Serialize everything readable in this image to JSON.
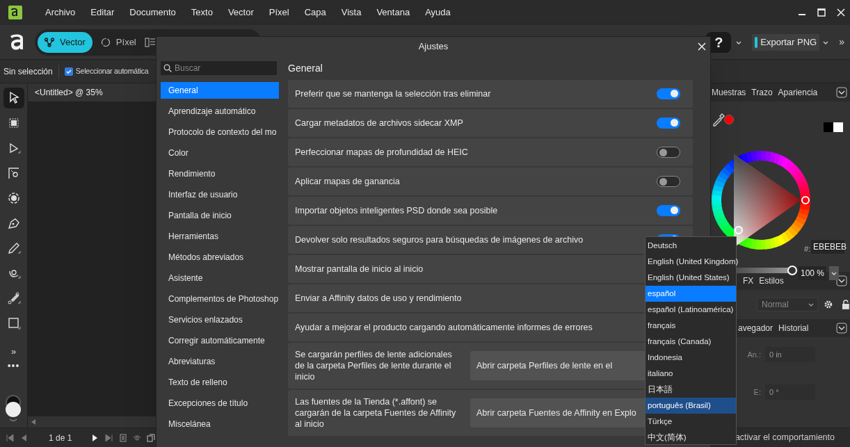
{
  "menu": [
    "Archivo",
    "Editar",
    "Documento",
    "Texto",
    "Vector",
    "Píxel",
    "Capa",
    "Vista",
    "Ventana",
    "Ayuda"
  ],
  "toolbar": {
    "personas": [
      {
        "label": "Vector",
        "selected": true
      },
      {
        "label": "Píxel",
        "selected": false
      }
    ],
    "help": "?",
    "export": "Exportar PNG",
    "more": "»"
  },
  "context_bar": {
    "selection": "Sin selección",
    "auto_select": {
      "label": "Seleccionar automática",
      "checked": true
    }
  },
  "document_tab": "<Untitled> @ 35%",
  "tools": [
    {
      "kind": "pointer",
      "selected": true
    },
    {
      "kind": "crop",
      "selected": false
    },
    {
      "kind": "node",
      "selected": false
    },
    {
      "kind": "corner",
      "selected": false
    },
    {
      "kind": "rotate",
      "selected": false
    },
    {
      "kind": "pen",
      "selected": false
    },
    {
      "kind": "pencil",
      "selected": false
    },
    {
      "kind": "brush",
      "selected": false
    },
    {
      "kind": "gradient",
      "selected": false
    },
    {
      "kind": "rectangle",
      "selected": false
    }
  ],
  "tools_more": [
    "»",
    "•••"
  ],
  "page_nav": "1 de 1",
  "dialog": {
    "title": "Ajustes",
    "search": {
      "placeholder": "Buscar"
    },
    "heading": "General",
    "categories": [
      {
        "label": "General",
        "selected": true
      },
      {
        "label": "Aprendizaje automático",
        "selected": false
      },
      {
        "label": "Protocolo de contexto del mo",
        "selected": false
      },
      {
        "label": "Color",
        "selected": false
      },
      {
        "label": "Rendimiento",
        "selected": false
      },
      {
        "label": "Interfaz de usuario",
        "selected": false
      },
      {
        "label": "Pantalla de inicio",
        "selected": false
      },
      {
        "label": "Herramientas",
        "selected": false
      },
      {
        "label": "Métodos abreviados",
        "selected": false
      },
      {
        "label": "Asistente",
        "selected": false
      },
      {
        "label": "Complementos de Photoshop",
        "selected": false
      },
      {
        "label": "Servicios enlazados",
        "selected": false
      },
      {
        "label": "Corregir automáticamente",
        "selected": false
      },
      {
        "label": "Abreviaturas",
        "selected": false
      },
      {
        "label": "Texto de relleno",
        "selected": false
      },
      {
        "label": "Excepciones de título",
        "selected": false
      },
      {
        "label": "Miscelánea",
        "selected": false
      }
    ],
    "settings": [
      {
        "kind": "toggle",
        "label": "Preferir que se mantenga la selección tras eliminar",
        "on": true
      },
      {
        "kind": "toggle",
        "label": "Cargar metadatos de archivos sidecar XMP",
        "on": true
      },
      {
        "kind": "toggle",
        "label": "Perfeccionar mapas de profundidad de HEIC",
        "on": false
      },
      {
        "kind": "toggle",
        "label": "Aplicar mapas de ganancia",
        "on": false
      },
      {
        "kind": "toggle",
        "label": "Importar objetos inteligentes PSD donde sea posible",
        "on": true
      },
      {
        "kind": "toggle",
        "label": "Devolver solo resultados seguros para búsquedas de imágenes de archivo",
        "on": true
      },
      {
        "kind": "text",
        "label": "Mostrar pantalla de inicio al inicio"
      },
      {
        "kind": "text",
        "label": "Enviar a Affinity datos de uso y rendimiento"
      },
      {
        "kind": "text",
        "label": "Ayudar a mejorar el producto cargando automáticamente informes de errores"
      },
      {
        "kind": "button",
        "label": "Se cargarán perfiles de lente adicionales de la carpeta Perfiles de lente durante el inicio",
        "button": "Abrir carpeta Perfiles de lente en el"
      },
      {
        "kind": "button",
        "label": "Las fuentes de la Tienda (*.affont) se cargarán de la carpeta Fuentes de Affinity al inicio",
        "button": "Abrir carpeta Fuentes de Affinity en Explo"
      }
    ]
  },
  "language_menu": [
    {
      "label": "Deutsch",
      "selected": false,
      "hovered": false
    },
    {
      "label": "English (United Kingdom)",
      "selected": false,
      "hovered": false
    },
    {
      "label": "English (United States)",
      "selected": false,
      "hovered": false
    },
    {
      "label": "español",
      "selected": true,
      "hovered": false
    },
    {
      "label": "español (Latinoamérica)",
      "selected": false,
      "hovered": false
    },
    {
      "label": "français",
      "selected": false,
      "hovered": false
    },
    {
      "label": "français (Canada)",
      "selected": false,
      "hovered": false
    },
    {
      "label": "Indonesia",
      "selected": false,
      "hovered": false
    },
    {
      "label": "italiano",
      "selected": false,
      "hovered": false
    },
    {
      "label": "日本語",
      "selected": false,
      "hovered": false
    },
    {
      "label": "português (Brasil)",
      "selected": false,
      "hovered": true
    },
    {
      "label": "Türkçe",
      "selected": false,
      "hovered": false
    },
    {
      "label": "中文(简体)",
      "selected": false,
      "hovered": false
    }
  ],
  "right_panel": {
    "color_tabs": [
      "Muestras",
      "Trazo",
      "Apariencia"
    ],
    "hex_label": "#:",
    "hex": "EBEBEB",
    "opacity": {
      "level": 1,
      "reading": "100 %"
    },
    "layer_tabs": [
      "FX",
      "Estilos"
    ],
    "blend_mode": "Normal",
    "transform_tabs": [
      "avegador",
      "Historial"
    ],
    "fields": [
      {
        "label": "An.:",
        "value": "0 in"
      },
      {
        "label": "E:",
        "value": "0 °"
      }
    ],
    "status": "activar el comportamiento"
  }
}
